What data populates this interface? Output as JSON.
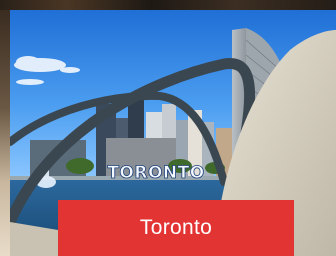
{
  "card": {
    "title": "Toronto",
    "sign_text": "TORONTO",
    "title_band_color": "#e33434"
  }
}
